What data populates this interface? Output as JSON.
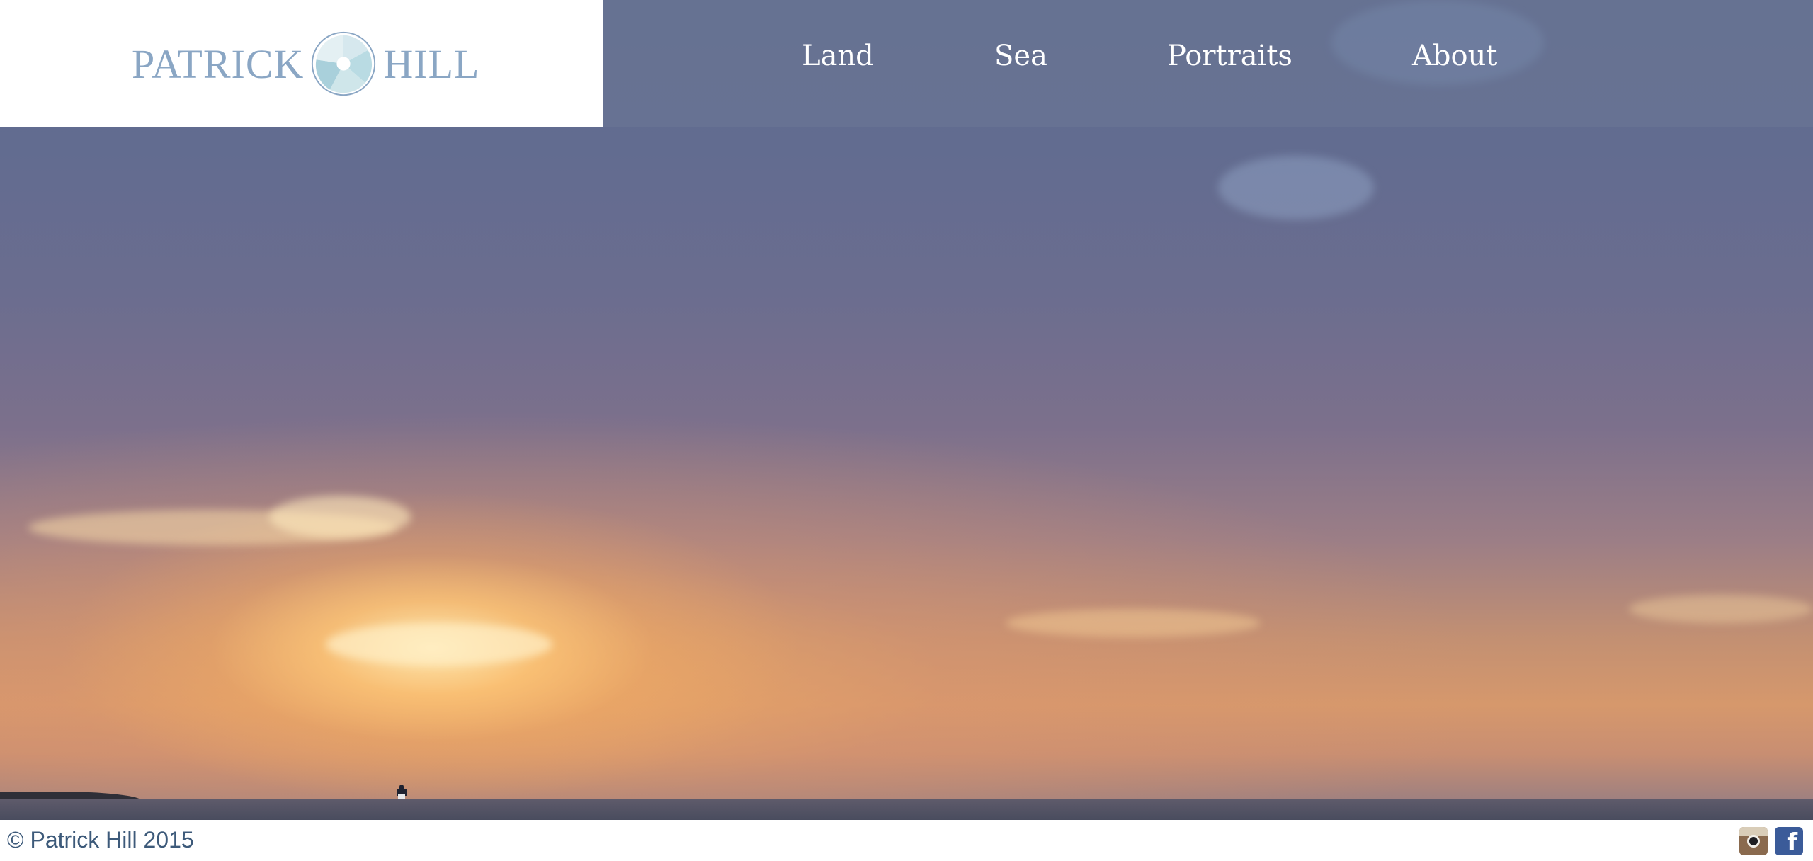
{
  "brand": {
    "name_left": "PATRICK",
    "name_right": "HILL",
    "color": "#8aa6c4"
  },
  "nav": {
    "items": [
      {
        "label": "Land"
      },
      {
        "label": "Sea"
      },
      {
        "label": "Portraits"
      },
      {
        "label": "About"
      }
    ]
  },
  "hero": {
    "icons": [
      "lighthouse-icon"
    ]
  },
  "footer": {
    "copyright": "© Patrick Hill 2015",
    "social": [
      {
        "icon": "instagram-icon",
        "color": "#8a6a4e"
      },
      {
        "icon": "facebook-icon",
        "glyph": "f",
        "color": "#3b5b99"
      }
    ]
  }
}
